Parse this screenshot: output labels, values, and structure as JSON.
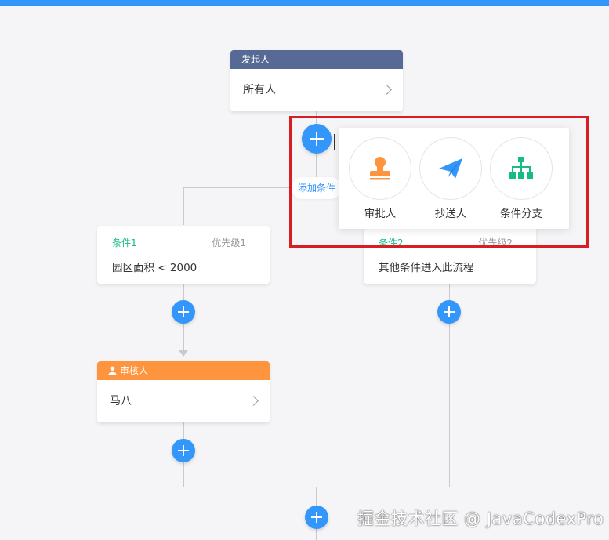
{
  "start_node": {
    "header": "发起人",
    "content": "所有人"
  },
  "add_condition_label": "添加条件",
  "popup": {
    "items": [
      {
        "label": "审批人",
        "icon": "approver-stamp-icon",
        "color": "#ff943e"
      },
      {
        "label": "抄送人",
        "icon": "paper-plane-icon",
        "color": "#3296fa"
      },
      {
        "label": "条件分支",
        "icon": "org-branch-icon",
        "color": "#15bc83"
      }
    ]
  },
  "branches": [
    {
      "title": "条件1",
      "priority": "优先级1",
      "content": "园区面积 < 2000"
    },
    {
      "title": "条件2",
      "priority": "优先级2",
      "content": "其他条件进入此流程"
    }
  ],
  "approver_node": {
    "header": "审核人",
    "content": "马八"
  },
  "watermark": "掘金技术社区 @ JavaCodexPro",
  "colors": {
    "primary": "#3296fa",
    "start_header": "#576a95",
    "approver_header": "#ff943e",
    "condition": "#15bc83",
    "highlight": "#d81e24"
  }
}
